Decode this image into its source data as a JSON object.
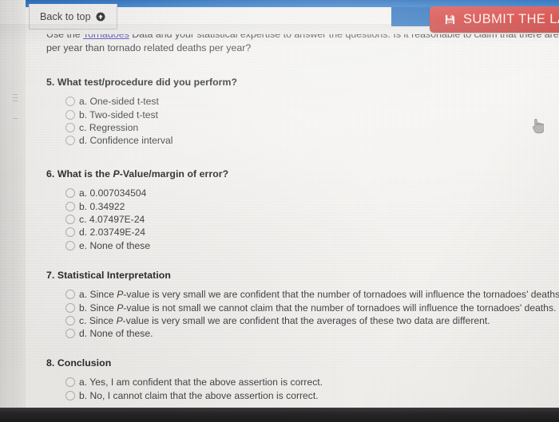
{
  "window": {
    "sticky_bar": {
      "back_to_top_label": "Back to top",
      "back_to_top_icon": "circle-up-arrow-icon",
      "submit_label": "SUBMIT THE LAB",
      "submit_icon": "floppy-save-icon",
      "submit_color": "#d93d39"
    },
    "cursor_icon": "pointing-hand-cursor"
  },
  "intro": {
    "line1_prefix": "Use the ",
    "line1_link": "Tornadoes",
    "line1_suffix": " Data and your statistical expertise to answer the questions. Is it reasonable to claim that there are more ob",
    "line2": "per year than tornado related deaths per year?",
    "link_color": "#5448b8"
  },
  "questions": [
    {
      "number": "5.",
      "title": "5. What test/procedure did you perform?",
      "options": [
        {
          "letter": "a.",
          "text": "a. One-sided t-test"
        },
        {
          "letter": "b.",
          "text": "b. Two-sided t-test"
        },
        {
          "letter": "c.",
          "text": "c. Regression"
        },
        {
          "letter": "d.",
          "text": "d. Confidence interval"
        }
      ]
    },
    {
      "number": "6.",
      "title": "6. What is the P-Value/margin of error?",
      "options": [
        {
          "letter": "a.",
          "text": "a. 0.007034504"
        },
        {
          "letter": "b.",
          "text": "b. 0.34922"
        },
        {
          "letter": "c.",
          "text": "c. 4.07497E-24"
        },
        {
          "letter": "d.",
          "text": "d. 2.03749E-24"
        },
        {
          "letter": "e.",
          "text": "e. None of these"
        }
      ]
    },
    {
      "number": "7.",
      "title": "7. Statistical Interpretation",
      "options": [
        {
          "letter": "a.",
          "text": "a. Since P-value is very small we are confident that the number of tornadoes will influence the tornadoes' deaths."
        },
        {
          "letter": "b.",
          "text": "b. Since P-value is not small we cannot claim that the number of tornadoes will influence the tornadoes' deaths."
        },
        {
          "letter": "c.",
          "text": "c. Since P-value is very small we are confident that the averages of these two data are different."
        },
        {
          "letter": "d.",
          "text": "d. None of these."
        }
      ]
    },
    {
      "number": "8.",
      "title": "8. Conclusion",
      "options": [
        {
          "letter": "a.",
          "text": "a. Yes, I am confident that the above assertion is correct."
        },
        {
          "letter": "b.",
          "text": "b. No, I cannot claim that the above assertion is correct."
        }
      ]
    }
  ]
}
